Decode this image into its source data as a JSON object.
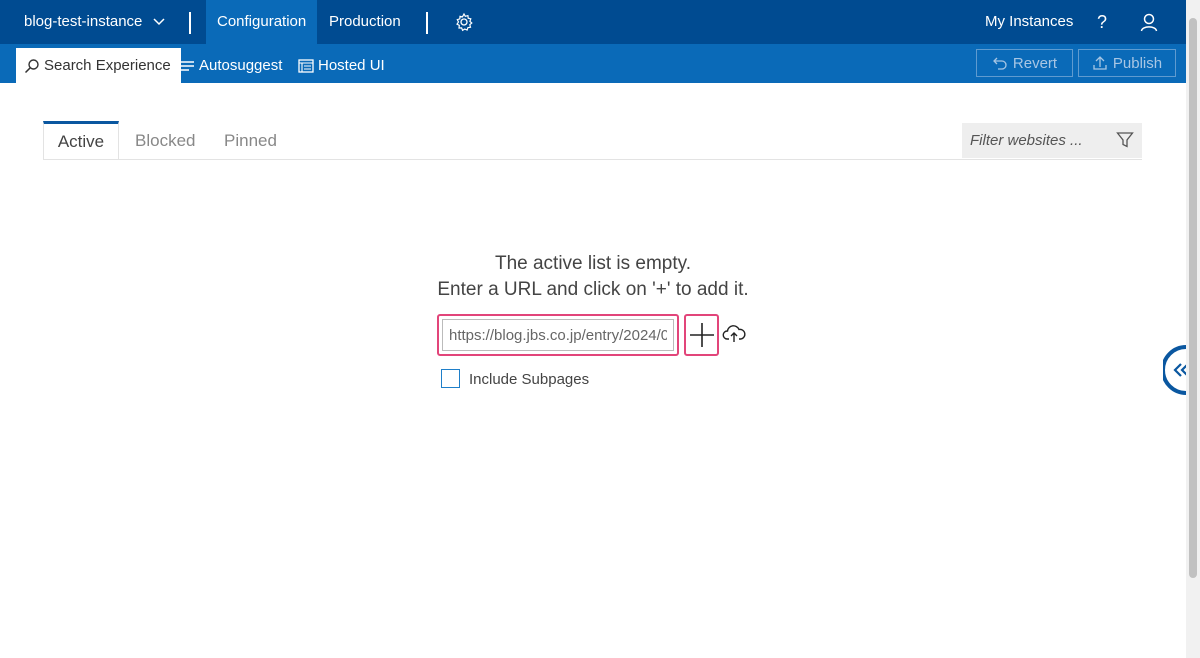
{
  "topbar": {
    "instance_name": "blog-test-instance",
    "nav": {
      "configuration": "Configuration",
      "production": "Production"
    },
    "my_instances": "My Instances",
    "help": "?"
  },
  "subbar": {
    "tabs": {
      "search_experience": "Search Experience",
      "autosuggest": "Autosuggest",
      "hosted_ui": "Hosted UI"
    },
    "revert": "Revert",
    "publish": "Publish"
  },
  "content_tabs": {
    "active": "Active",
    "blocked": "Blocked",
    "pinned": "Pinned"
  },
  "filter": {
    "placeholder": "Filter websites ..."
  },
  "empty_state": {
    "line1": "The active list is empty.",
    "line2": "Enter a URL and click on '+' to add it."
  },
  "url_input": {
    "value": "https://blog.jbs.co.jp/entry/2024/0"
  },
  "include_subpages": "Include Subpages",
  "colors": {
    "header": "#004b91",
    "subheader": "#0a6ab8",
    "highlight": "#e2457a"
  },
  "icons": [
    "chevron-down-icon",
    "gear-icon",
    "user-icon",
    "search-icon",
    "list-icon",
    "hosted-ui-icon",
    "revert-icon",
    "publish-icon",
    "filter-icon",
    "plus-icon",
    "cloud-upload-icon",
    "double-chevron-left-icon"
  ]
}
